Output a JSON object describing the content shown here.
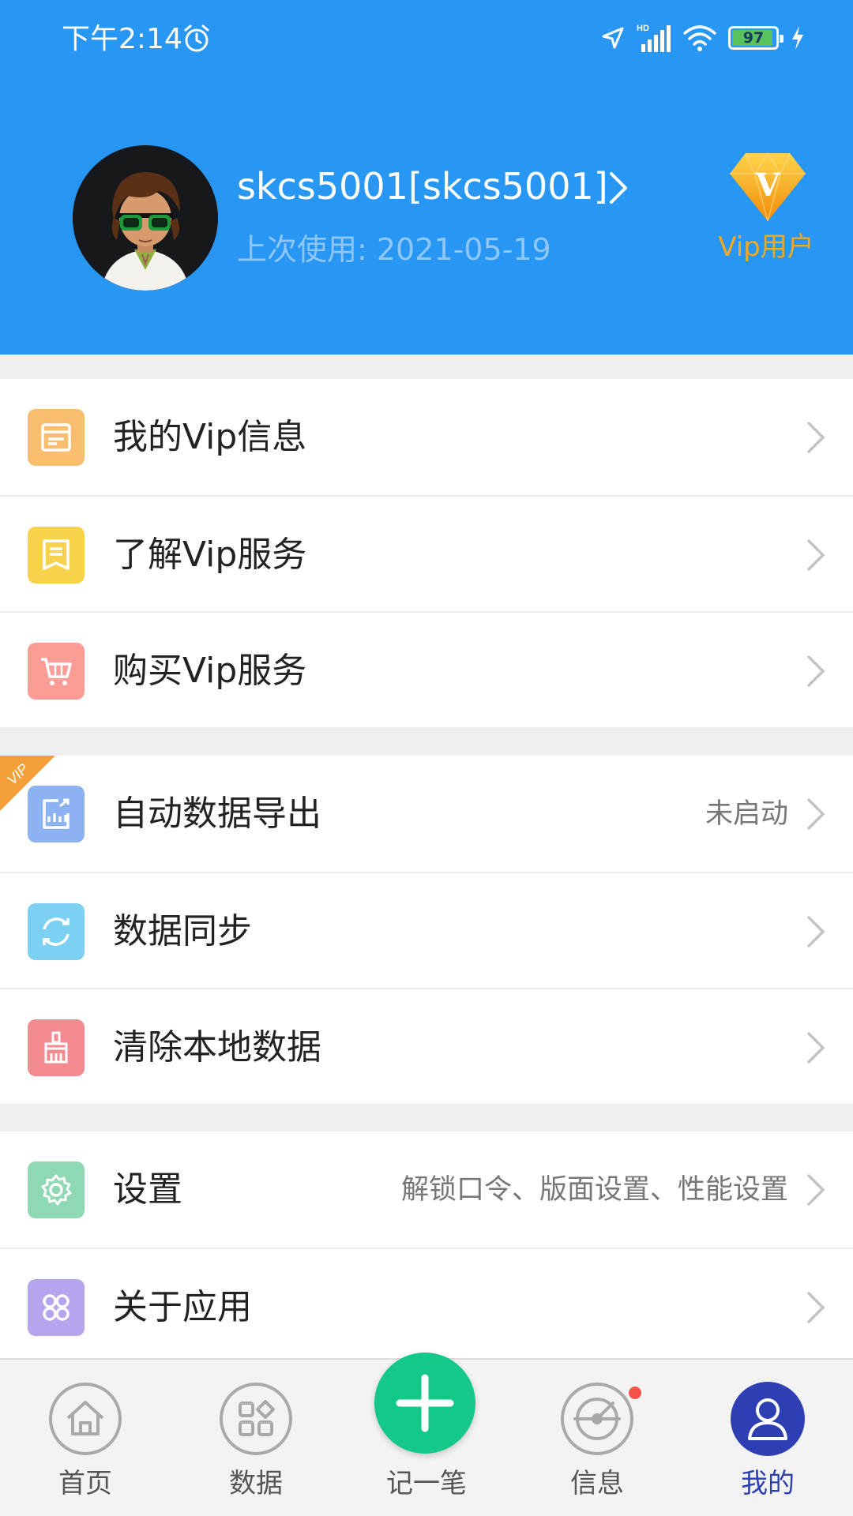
{
  "status_bar": {
    "time": "下午2:14",
    "battery": "97",
    "network_label": "HD"
  },
  "profile": {
    "username": "skcs5001[skcs5001]",
    "last_used": "上次使用: 2021-05-19",
    "vip_letter": "V",
    "vip_label": "Vip用户"
  },
  "menu_groups": [
    {
      "items": [
        {
          "label": "我的Vip信息",
          "icon": "vip-info-icon",
          "color": "#f9bd6e"
        },
        {
          "label": "了解Vip服务",
          "icon": "vip-service-icon",
          "color": "#f6d34a"
        },
        {
          "label": "购买Vip服务",
          "icon": "cart-icon",
          "color": "#fb9c95"
        }
      ]
    },
    {
      "items": [
        {
          "label": "自动数据导出",
          "value": "未启动",
          "icon": "export-icon",
          "color": "#8db2f1",
          "vip_tag": "VIP"
        },
        {
          "label": "数据同步",
          "icon": "sync-icon",
          "color": "#7cd0f1"
        },
        {
          "label": "清除本地数据",
          "icon": "broom-icon",
          "color": "#f38a8f"
        }
      ]
    },
    {
      "items": [
        {
          "label": "设置",
          "value": "解锁口令、版面设置、性能设置",
          "icon": "gear-icon",
          "color": "#8ed8b3"
        },
        {
          "label": "关于应用",
          "icon": "apps-icon",
          "color": "#b6a4ef"
        }
      ]
    }
  ],
  "bottom_nav": {
    "items": [
      {
        "label": "首页",
        "icon": "home-icon"
      },
      {
        "label": "数据",
        "icon": "data-icon"
      },
      {
        "label": "记一笔",
        "icon": "add-icon"
      },
      {
        "label": "信息",
        "icon": "radar-icon"
      },
      {
        "label": "我的",
        "icon": "user-icon"
      }
    ]
  },
  "colors": {
    "header_blue": "#2896f3",
    "vip_gold": "#f4a91c",
    "add_green": "#14c887",
    "active_nav": "#2d3fb2"
  }
}
